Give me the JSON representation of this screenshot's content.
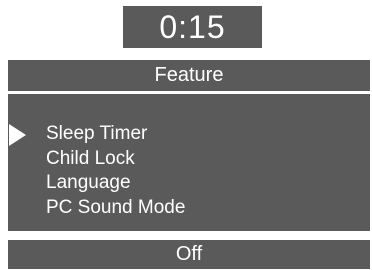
{
  "clock": {
    "time": "0:15"
  },
  "menu": {
    "title": "Feature",
    "selected_index": 0,
    "items": [
      {
        "label": "Sleep Timer"
      },
      {
        "label": "Child Lock"
      },
      {
        "label": "Language"
      },
      {
        "label": "PC Sound Mode"
      }
    ]
  },
  "status": {
    "value": "Off"
  },
  "icons": {
    "pointer": "selection-arrow-icon"
  },
  "colors": {
    "panel": "#5a5a5a",
    "text": "#ffffff",
    "background": "#ffffff"
  }
}
